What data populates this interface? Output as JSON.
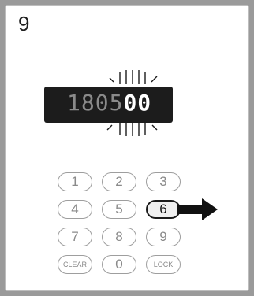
{
  "step_number": "9",
  "display": {
    "dim_digits": "1805",
    "lit_digits": "00"
  },
  "keypad": {
    "rows": [
      [
        "1",
        "2",
        "3"
      ],
      [
        "4",
        "5",
        "6"
      ],
      [
        "7",
        "8",
        "9"
      ],
      [
        "CLEAR",
        "0",
        "LOCK"
      ]
    ],
    "highlighted_key": "6"
  },
  "icons": {
    "arrow": "arrow-right-icon",
    "flash": "flash-rays-icon"
  },
  "colors": {
    "display_bg": "#1c1c1c",
    "lit_segment": "#ffffff",
    "dim_segment": "#8a8a8a",
    "arrow": "#111111"
  }
}
